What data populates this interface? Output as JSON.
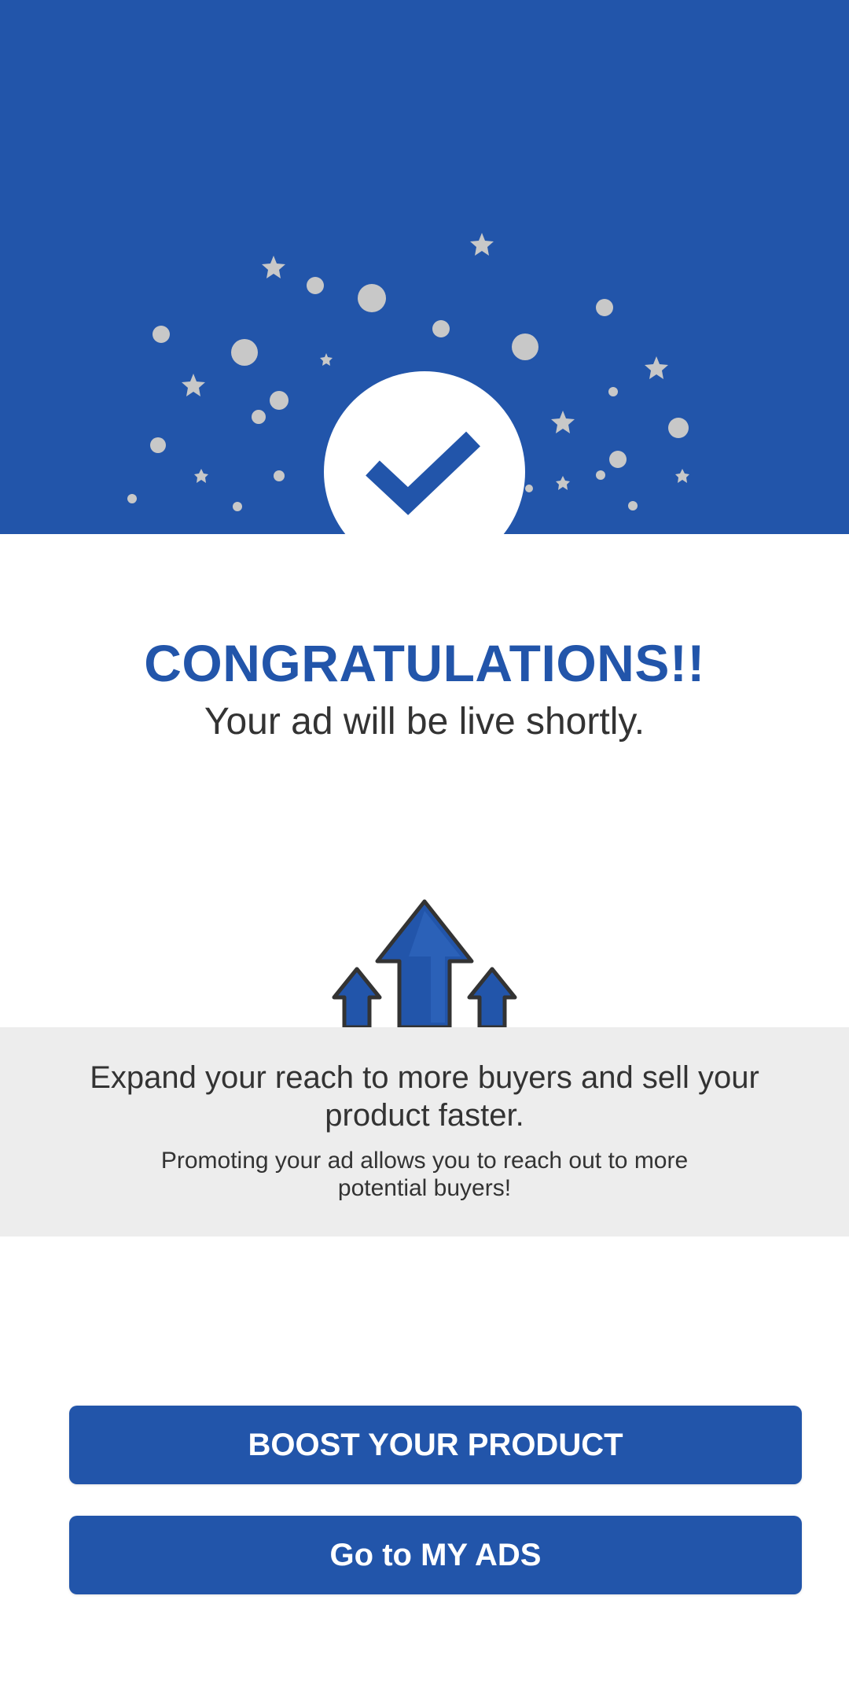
{
  "colors": {
    "primary": "#2255aa",
    "confetti": "#c8c8c8",
    "band": "#ededed",
    "text": "#333333",
    "white": "#ffffff"
  },
  "hero": {
    "icon": "checkmark-icon",
    "decoration": "confetti-dots-and-stars"
  },
  "heading": {
    "title": "CONGRATULATIONS!!",
    "subtitle": "Your ad will be live shortly."
  },
  "promo": {
    "icon": "growth-arrows-icon",
    "headline": "Expand your reach to more buyers and sell your product faster.",
    "body": "Promoting your ad allows you to reach out to more potential buyers!"
  },
  "actions": {
    "boost_label": "BOOST YOUR PRODUCT",
    "my_ads_label": "Go to MY ADS"
  }
}
